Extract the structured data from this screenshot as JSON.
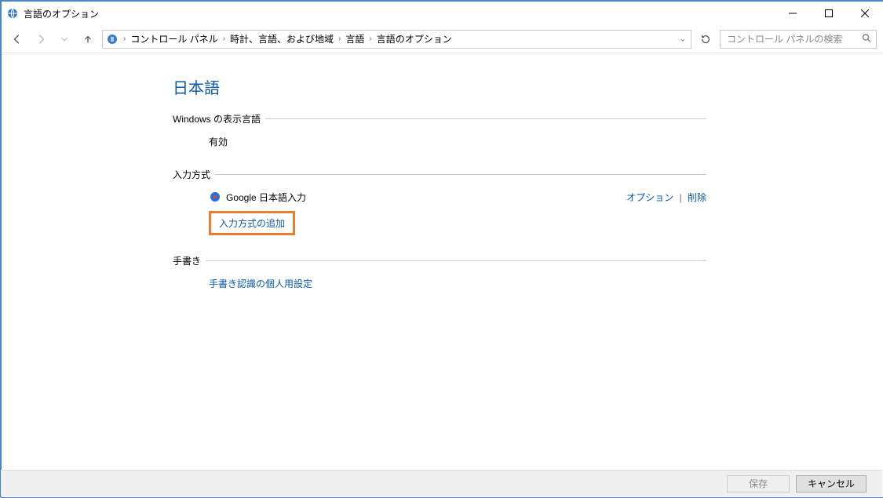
{
  "window": {
    "title": "言語のオプション"
  },
  "breadcrumb": {
    "items": [
      "コントロール パネル",
      "時計、言語、および地域",
      "言語",
      "言語のオプション"
    ]
  },
  "search": {
    "placeholder": "コントロール パネルの検索"
  },
  "page": {
    "language_name": "日本語",
    "sections": {
      "display_language": {
        "title": "Windows の表示言語",
        "status": "有効"
      },
      "input_method": {
        "title": "入力方式",
        "ime_name": "Google 日本語入力",
        "option_label": "オプション",
        "remove_label": "削除",
        "add_label": "入力方式の追加"
      },
      "handwriting": {
        "title": "手書き",
        "personalize_label": "手書き認識の個人用設定"
      }
    }
  },
  "footer": {
    "save": "保存",
    "cancel": "キャンセル"
  }
}
